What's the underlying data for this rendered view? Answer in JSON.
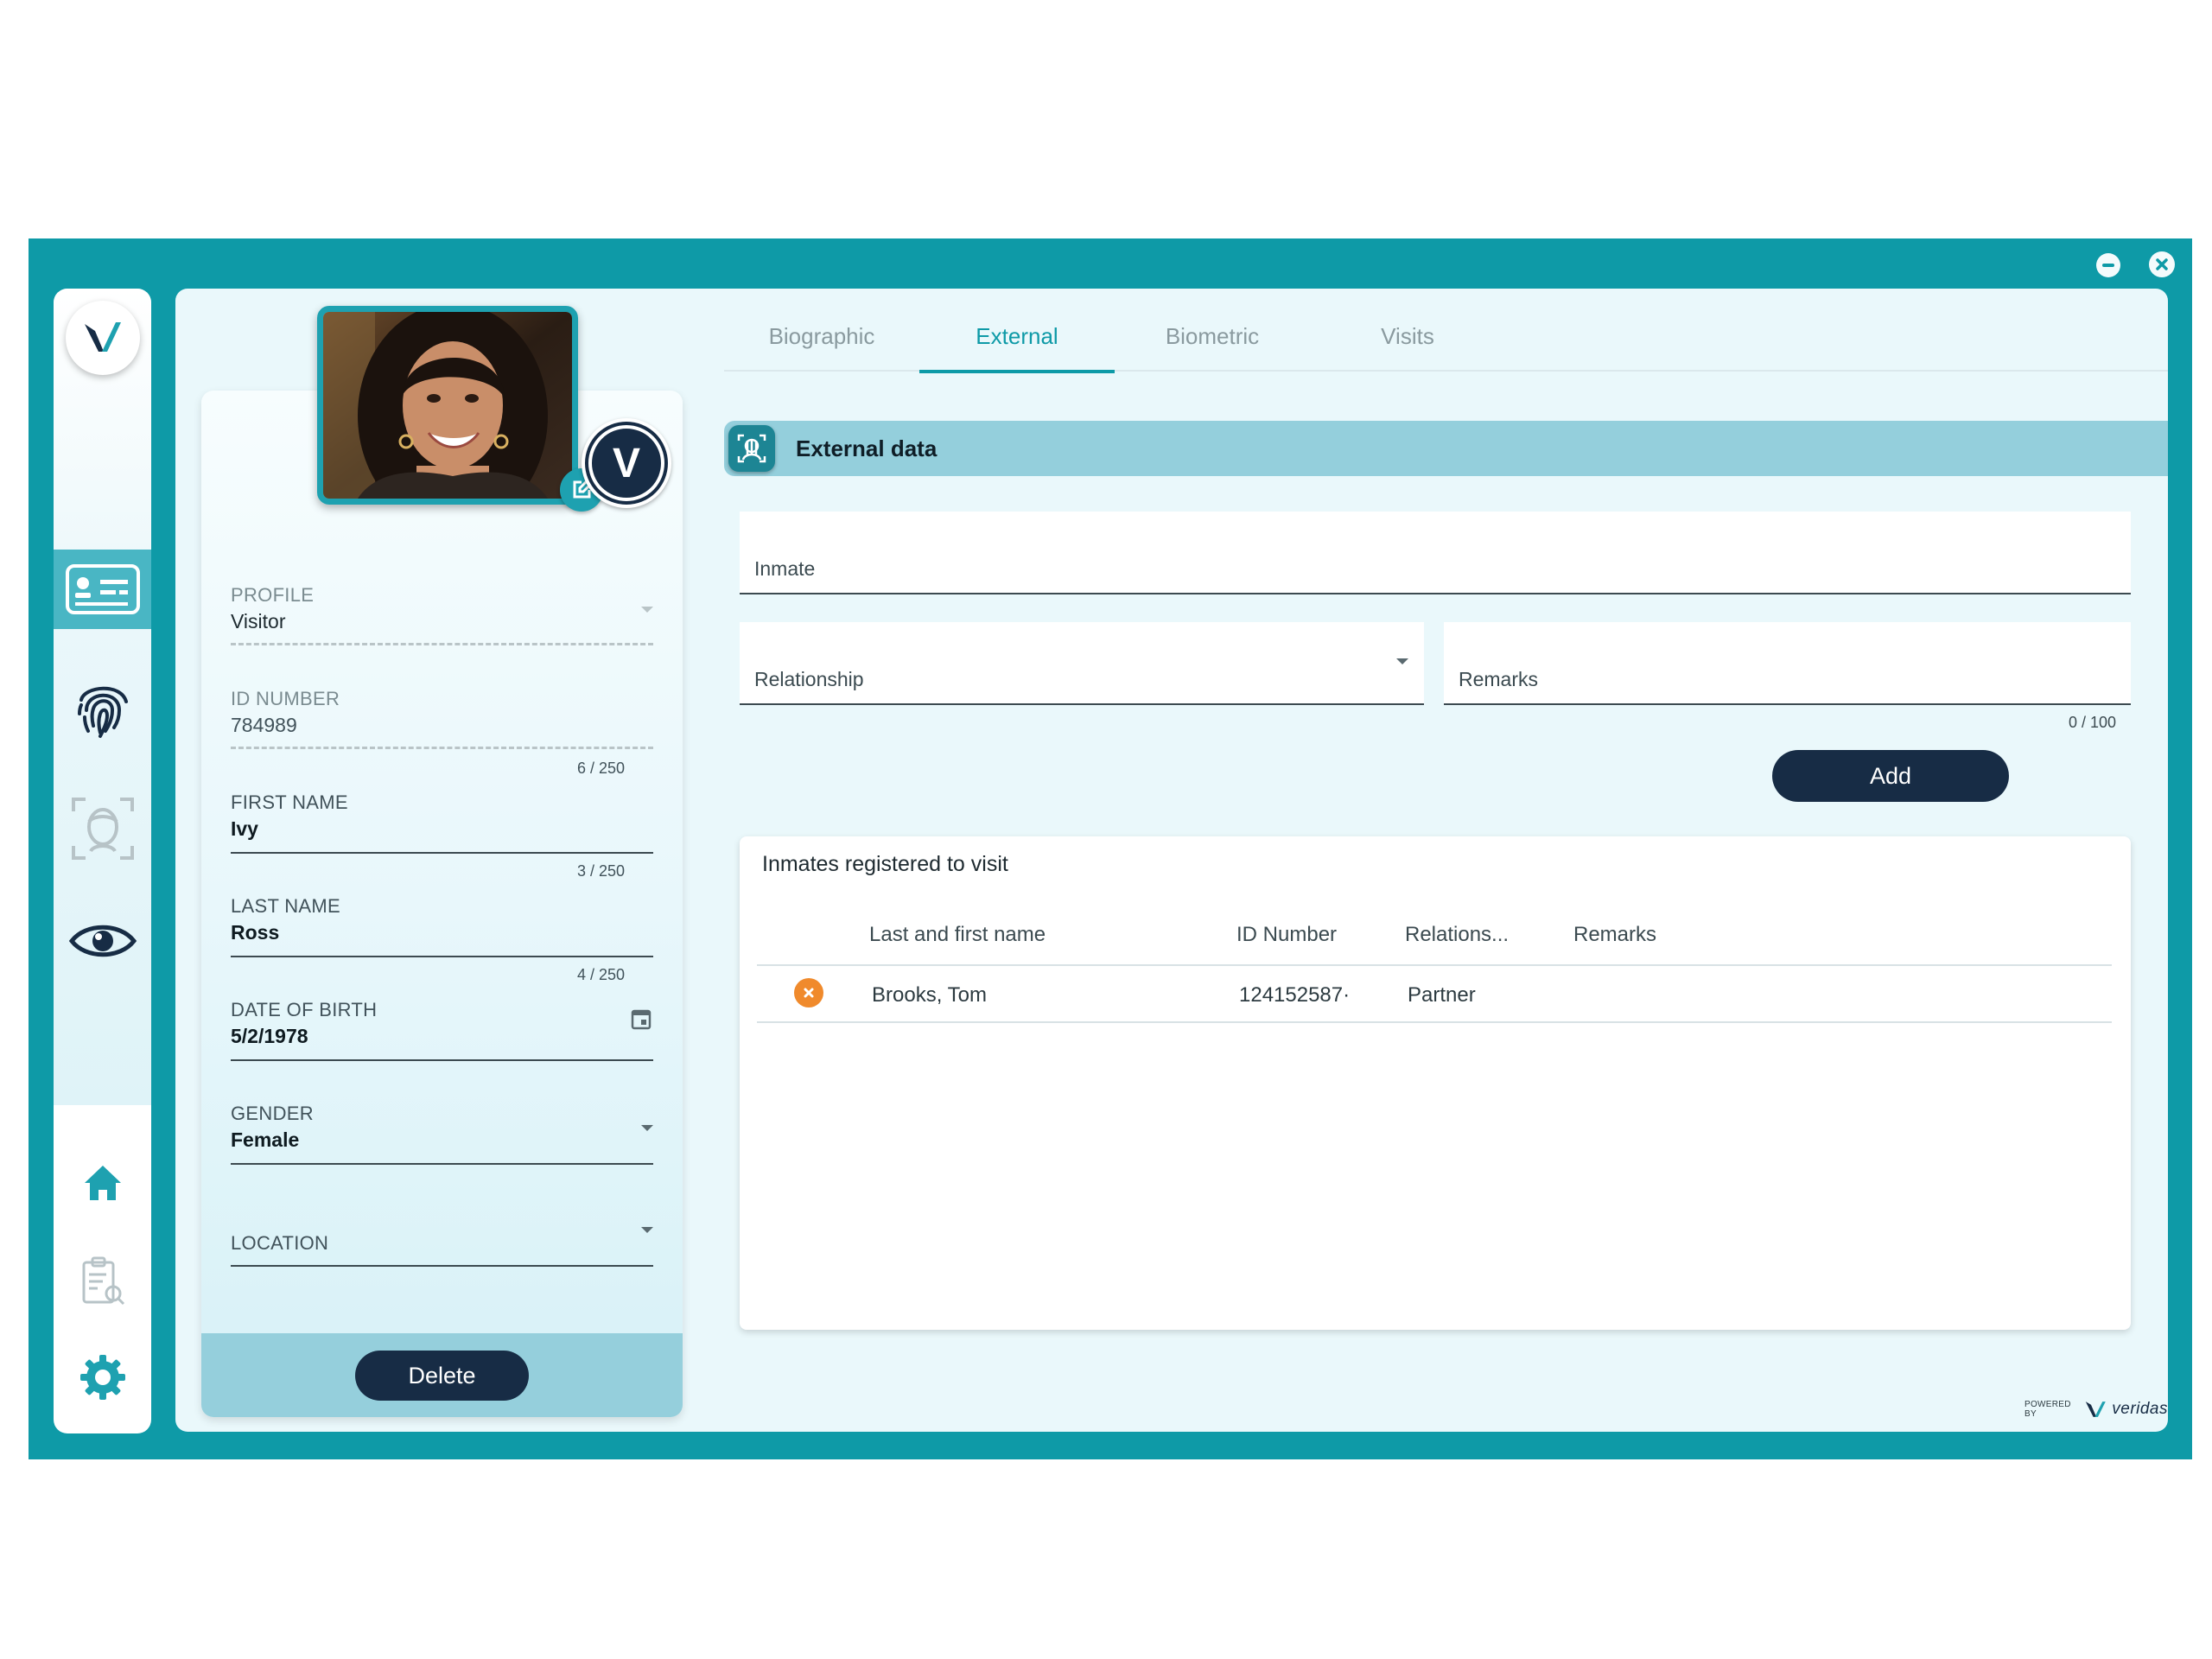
{
  "window": {
    "minimize_icon": "minimize-icon",
    "close_icon": "close-icon"
  },
  "sidebar": {
    "logo": "V",
    "items": [
      {
        "name": "id-card-icon",
        "active": true
      },
      {
        "name": "fingerprint-icon",
        "active": false
      },
      {
        "name": "face-scan-icon",
        "active": false
      },
      {
        "name": "eye-icon",
        "active": false
      },
      {
        "name": "home-icon",
        "active": false
      },
      {
        "name": "report-search-icon",
        "active": false
      },
      {
        "name": "settings-icon",
        "active": false
      }
    ]
  },
  "profile_card": {
    "badge_letter": "V",
    "fields": {
      "profile": {
        "label": "PROFILE",
        "value": "Visitor"
      },
      "id_number": {
        "label": "ID NUMBER",
        "value": "784989",
        "count": "6 / 250"
      },
      "first_name": {
        "label": "FIRST NAME",
        "value": "Ivy",
        "count": "3 / 250"
      },
      "last_name": {
        "label": "LAST NAME",
        "value": "Ross",
        "count": "4 / 250"
      },
      "date_of_birth": {
        "label": "DATE OF BIRTH",
        "value": "5/2/1978"
      },
      "gender": {
        "label": "GENDER",
        "value": "Female"
      },
      "location": {
        "label": "LOCATION",
        "value": ""
      }
    },
    "delete_label": "Delete"
  },
  "tabs": [
    {
      "label": "Biographic",
      "active": false
    },
    {
      "label": "External",
      "active": true
    },
    {
      "label": "Biometric",
      "active": false
    },
    {
      "label": "Visits",
      "active": false
    }
  ],
  "external": {
    "section_title": "External data",
    "inmate_label": "Inmate",
    "relationship_label": "Relationship",
    "remarks_label": "Remarks",
    "remarks_counter": "0 / 100",
    "add_label": "Add"
  },
  "inmates_table": {
    "title": "Inmates registered to visit",
    "columns": [
      "Last and first name",
      "ID Number",
      "Relations...",
      "Remarks"
    ],
    "rows": [
      {
        "name": "Brooks, Tom",
        "id_number": "124152587·",
        "relationship": "Partner",
        "remarks": ""
      }
    ]
  },
  "footer": {
    "powered_by": "POWERED BY",
    "brand": "veridas"
  },
  "colors": {
    "frame": "#0e9aa7",
    "accent": "#0e9aa7",
    "navy": "#172c45",
    "remove": "#f08a2c"
  }
}
